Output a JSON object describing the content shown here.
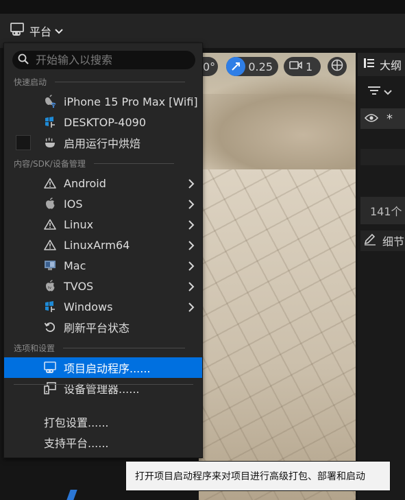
{
  "toolbar": {
    "platform_label": "平台"
  },
  "viewport": {
    "angle_value": "0°",
    "scale_value": "0.25",
    "camera_value": "1"
  },
  "outliner": {
    "title": "大纲",
    "count_text": "141个",
    "details_title": "细节"
  },
  "menu": {
    "search_placeholder": "开始输入以搜索",
    "sections": {
      "quick_launch": "快速启动",
      "content_sdk": "内容/SDK/设备管理",
      "options": "选项和设置"
    },
    "quick_launch_items": [
      {
        "label": "iPhone 15 Pro Max [Wifi]",
        "icon": "apple-wifi-icon"
      },
      {
        "label": "DESKTOP-4090",
        "icon": "windows-device-icon"
      },
      {
        "label": "启用运行中烘焙",
        "icon": "bake-icon"
      }
    ],
    "platform_items": [
      {
        "label": "Android",
        "icon": "warning-icon"
      },
      {
        "label": "IOS",
        "icon": "apple-icon"
      },
      {
        "label": "Linux",
        "icon": "warning-icon"
      },
      {
        "label": "LinuxArm64",
        "icon": "warning-icon"
      },
      {
        "label": "Mac",
        "icon": "mac-icon"
      },
      {
        "label": "TVOS",
        "icon": "apple-tv-icon"
      },
      {
        "label": "Windows",
        "icon": "windows-icon"
      },
      {
        "label": "刷新平台状态",
        "icon": "refresh-icon"
      }
    ],
    "option_items": [
      {
        "label": "项目启动程序......",
        "icon": "project-launcher-icon",
        "selected": true
      },
      {
        "label": "设备管理器......",
        "icon": "device-manager-icon",
        "selected": false
      }
    ],
    "bottom_items": [
      "打包设置......",
      "支持平台......"
    ]
  },
  "tooltip": {
    "text": "打开项目启动程序来对项目进行高级打包、部署和启动"
  },
  "colors": {
    "selection": "#0070e0",
    "menu_bg": "#262626",
    "accent_pill": "#2f7ee6"
  }
}
